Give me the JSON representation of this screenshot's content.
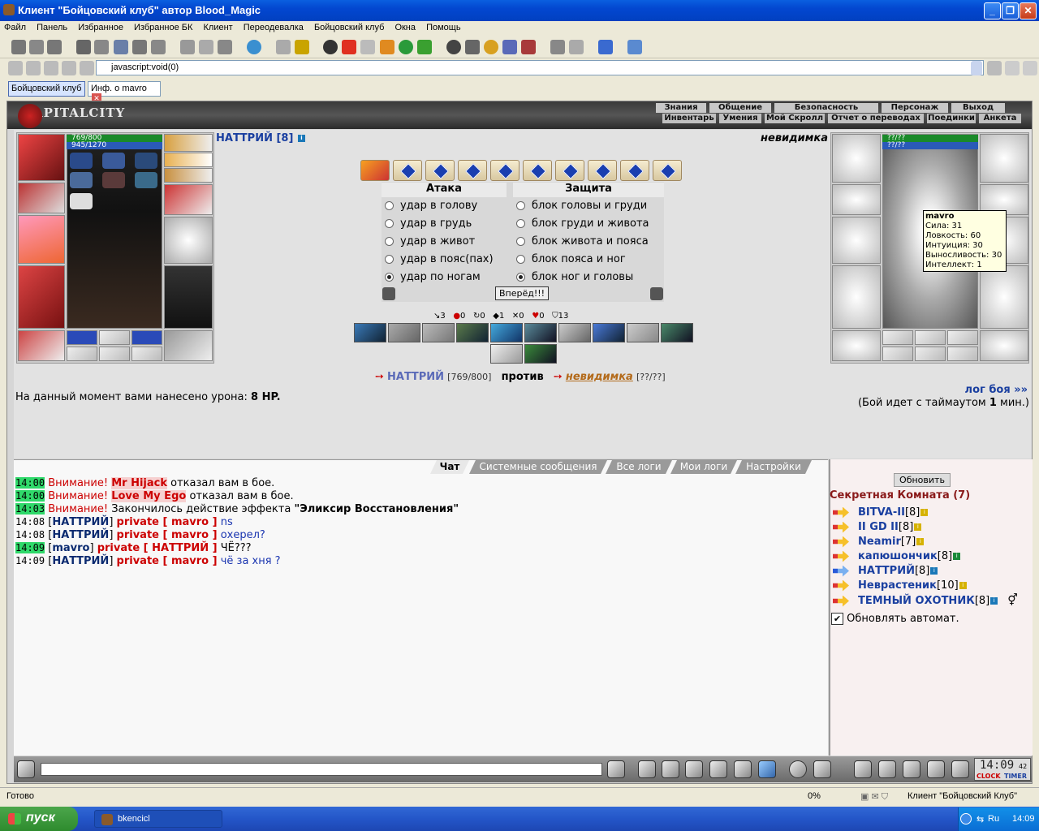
{
  "window": {
    "title": "Клиент \"Бойцовский клуб\" автор Blood_Magic"
  },
  "menu": [
    "Файл",
    "Панель",
    "Избранное",
    "Избранное БК",
    "Клиент",
    "Переодевалка",
    "Бойцовский клуб",
    "Окна",
    "Помощь"
  ],
  "address": {
    "value": "javascript:void(0)"
  },
  "doc_tabs": [
    {
      "label": "Бойцовский клуб"
    },
    {
      "label": "Инф. о mavro"
    }
  ],
  "game": {
    "logo": "CAPITALCITY",
    "nav_top": [
      "Знания",
      "Общение",
      "Безопасность",
      "Персонаж",
      "Выход"
    ],
    "nav_bottom": [
      "Инвентарь",
      "Умения",
      "Мой Скролл",
      "Отчет о переводах",
      "Поединки",
      "Анкета"
    ]
  },
  "player": {
    "name": "НАТТРИЙ [8]",
    "hp": "769/800",
    "mana": "945/1270"
  },
  "enemy": {
    "name": "невидимка",
    "hp": "??/??",
    "mana": "??/??"
  },
  "tooltip": {
    "title": "mavro",
    "lines": [
      "Сила: 31",
      "Ловкость: 60",
      "Интуиция: 30",
      "Выносливость: 30",
      "Интеллект: 1"
    ]
  },
  "fight": {
    "attack_header": "Атака",
    "defense_header": "Защита",
    "attacks": [
      "удар в голову",
      "удар в грудь",
      "удар в живот",
      "удар в пояс(пах)",
      "удар по ногам"
    ],
    "defenses": [
      "блок головы и груди",
      "блок груди и живота",
      "блок живота и пояса",
      "блок пояса и ног",
      "блок ног и головы"
    ],
    "attack_selected": 4,
    "defense_selected": 4,
    "go_button": "Вперёд!!!",
    "stats": [
      "3",
      "0",
      "0",
      "1",
      "0",
      "0",
      "13"
    ],
    "versus_player": "НАТТРИЙ",
    "versus_player_hp": "[769/800]",
    "versus_word": "против",
    "versus_enemy": "невидимка",
    "versus_enemy_hp": "[??/??]",
    "damage_text": "На данный момент вами нанесено урона:",
    "damage_value": "8 HP.",
    "log_link": "лог боя »»",
    "timeout_pre": "(Бой идет с таймаутом",
    "timeout_val": "1",
    "timeout_post": "мин.)"
  },
  "chat_tabs": [
    "Чат",
    "Системные сообщения",
    "Все логи",
    "Мои логи",
    "Настройки"
  ],
  "chat": [
    {
      "time": "14:00",
      "type": "warn",
      "prefix": "Внимание!",
      "name": "Mr Hijack",
      "text": "отказал вам в бое."
    },
    {
      "time": "14:00",
      "type": "warn",
      "prefix": "Внимание!",
      "name": "Love My Ego",
      "text": "отказал вам в бое."
    },
    {
      "time": "14:03",
      "type": "effect",
      "prefix": "Внимание!",
      "text": "Закончилось действие эффекта",
      "effect": "\"Эликсир Восстановления\""
    },
    {
      "time": "14:08",
      "type": "priv",
      "from": "НАТТРИЙ",
      "to": "private [ mavro ]",
      "text": "ns"
    },
    {
      "time": "14:08",
      "type": "priv",
      "from": "НАТТРИЙ",
      "to": "private [ mavro ]",
      "text": "охерел?"
    },
    {
      "time": "14:09",
      "type": "priv",
      "from": "mavro",
      "to": "private [ НАТТРИЙ ]",
      "text": "ЧЁ???"
    },
    {
      "time": "14:09",
      "type": "priv",
      "from": "НАТТРИЙ",
      "to": "private [ mavro ]",
      "text": "чё за хня ?"
    }
  ],
  "room": {
    "refresh": "Обновить",
    "title": "Секретная Комната (7)",
    "users": [
      {
        "name": "BITVA-II",
        "level": "[8]"
      },
      {
        "name": "II GD II",
        "level": "[8]"
      },
      {
        "name": "Neamir",
        "level": "[7]"
      },
      {
        "name": "капюшончик",
        "level": "[8]"
      },
      {
        "name": "НАТТРИЙ",
        "level": "[8]"
      },
      {
        "name": "Неврастеник",
        "level": "[10]"
      },
      {
        "name": "ТЕМНЫЙ ОХОТНИК",
        "level": "[8]"
      }
    ],
    "auto_refresh": "Обновлять автомат."
  },
  "clock": {
    "time": "14:09",
    "seconds": "42",
    "labels": [
      "CLOCK",
      "TIMER"
    ]
  },
  "status": {
    "text": "Готово",
    "percent": "0%",
    "client": "Клиент \"Бойцовский Клуб\""
  },
  "taskbar": {
    "start": "пуск",
    "task": "bkencicl",
    "lang": "Ru",
    "time": "14:09"
  }
}
